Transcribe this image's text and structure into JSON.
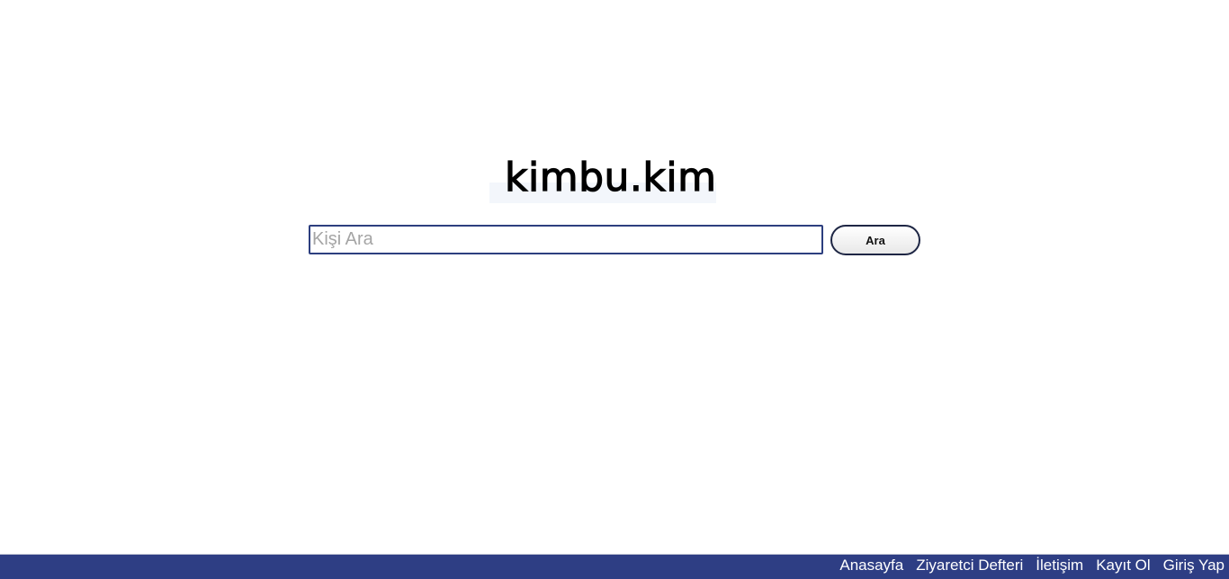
{
  "brand": {
    "logo_text": "kimbu.kim"
  },
  "search": {
    "placeholder": "Kişi Ara",
    "value": "",
    "button_label": "Ara"
  },
  "footer": {
    "links": [
      {
        "label": "Anasayfa"
      },
      {
        "label": "Ziyaretci Defteri"
      },
      {
        "label": "İletişim"
      },
      {
        "label": "Kayıt Ol"
      },
      {
        "label": "Giriş Yap"
      }
    ]
  },
  "colors": {
    "footer_background": "#2e3e84",
    "input_border": "#2d3f7f",
    "button_border": "#1e2644",
    "footer_text": "#ffffff"
  }
}
